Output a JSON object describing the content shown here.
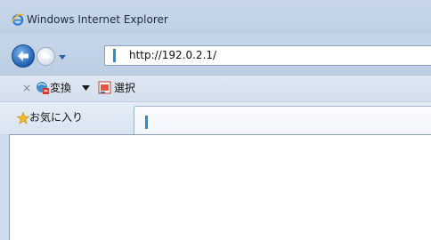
{
  "window": {
    "title": "Windows Internet Explorer"
  },
  "navigation": {
    "address": "http://192.0.2.1/"
  },
  "toolbar": {
    "translate_label": "変換",
    "select_label": "選択"
  },
  "favorites": {
    "label": "お気に入り"
  },
  "icons": {
    "title": "ie-logo-icon",
    "back": "back-arrow-icon",
    "forward": "forward-arrow-icon",
    "close": "close-icon",
    "favorites": "star-icon"
  },
  "colors": {
    "chrome": "#cfdbea",
    "accent": "#1f5fb0"
  }
}
